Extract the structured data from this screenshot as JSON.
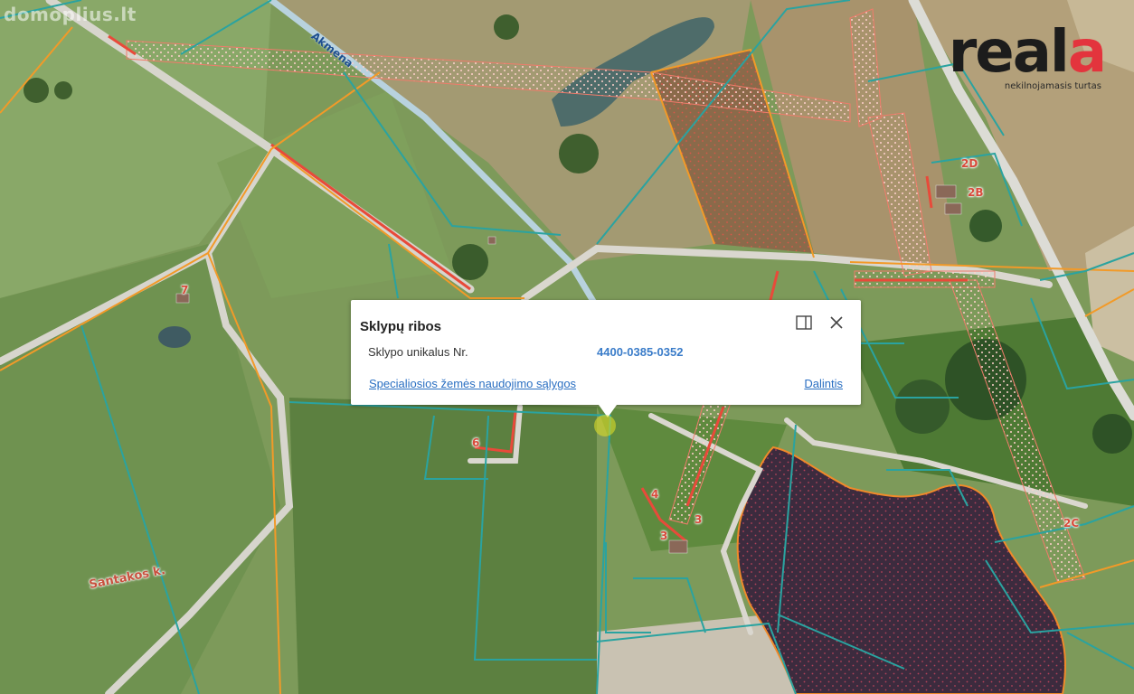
{
  "watermark": "domoplius.lt",
  "logo": {
    "word_main": "real",
    "word_accent": "a",
    "tagline": "nekilnojamasis turtas",
    "accent_color": "#e3343d"
  },
  "map_labels": {
    "road": "Akmena",
    "village": "Santakos k.",
    "lot_6": "6",
    "lot_7": "7",
    "lot_4": "4",
    "lot_3": "3",
    "lot_3b": "3",
    "lot_2d": "2D",
    "lot_2b": "2B",
    "lot_2c": "2C"
  },
  "popup": {
    "title": "Sklypų ribos",
    "field_label": "Sklypo unikalus Nr.",
    "field_value": "4400-0385-0352",
    "link_conditions": "Specialiosios žemės naudojimo sąlygos",
    "link_share": "Dalintis",
    "icons": [
      "sidebar-icon",
      "close-icon"
    ]
  },
  "colors": {
    "parcel_teal": "#2aa3a0",
    "parcel_orange": "#f29a28",
    "restriction_red": "#e84a3a",
    "road_grey": "#dcdcd6",
    "lake": "#3b2a3a"
  }
}
